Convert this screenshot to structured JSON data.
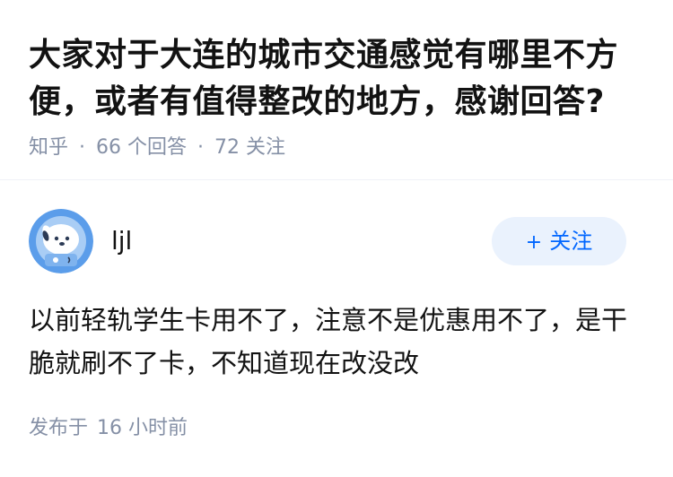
{
  "question": {
    "title": "大家对于大连的城市交通感觉有哪里不方便，或者有值得整改的地方，感谢回答?",
    "source": "知乎",
    "answer_count": "66 个回答",
    "follower_count": "72 关注"
  },
  "answer": {
    "author": {
      "name": "ljl",
      "avatar_icon": "astronaut-dog-avatar"
    },
    "follow_button": {
      "plus": "+",
      "label": "关注"
    },
    "content": "以前轻轨学生卡用不了，注意不是优惠用不了，是干脆就刷不了卡，不知道现在改没改",
    "publish_label": "发布于",
    "publish_time": "16 小时前"
  },
  "colors": {
    "title": "#121212",
    "meta": "#8590a6",
    "accent": "#0066ff",
    "follow_bg": "#eaf2fd",
    "avatar_bg": "#5b9dea"
  }
}
